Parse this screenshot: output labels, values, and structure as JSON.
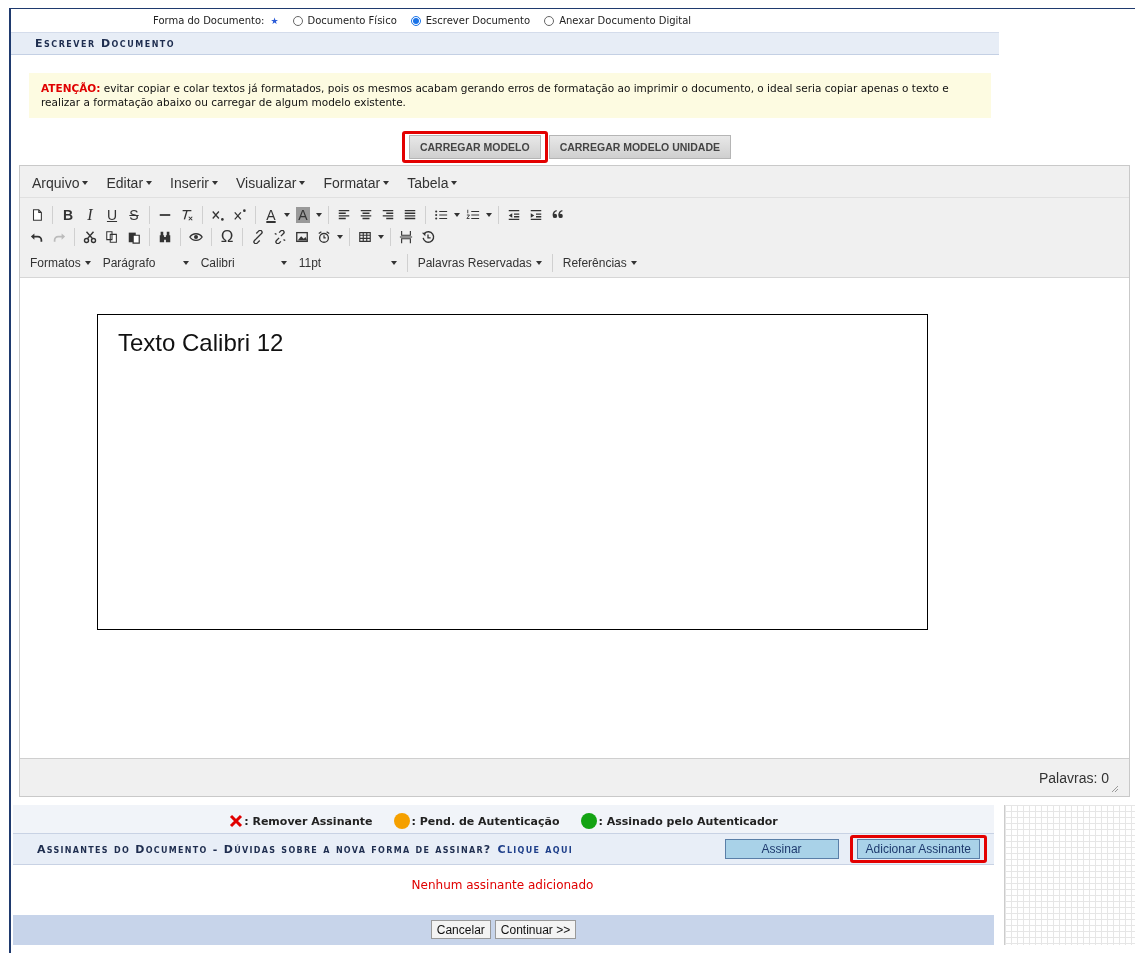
{
  "document_form": {
    "label": "Forma do Documento:",
    "required_mark": "★",
    "options": [
      {
        "label": "Documento Físico",
        "selected": false
      },
      {
        "label": "Escrever Documento",
        "selected": true
      },
      {
        "label": "Anexar Documento Digital",
        "selected": false
      }
    ]
  },
  "section": {
    "title": "Escrever Documento"
  },
  "warning": {
    "text": "**ATENÇÃO:** evitar copiar e colar textos já formatados, pois os mesmos acabam gerando erros de formatação ao imprimir o documento, o ideal seria copiar apenas o texto e realizar a formatação abaixo ou carregar de algum modelo existente."
  },
  "template_buttons": [
    {
      "label": "CARREGAR MODELO",
      "highlighted": true
    },
    {
      "label": "CARREGAR MODELO UNIDADE",
      "highlighted": false
    }
  ],
  "editor": {
    "menus": [
      "Arquivo",
      "Editar",
      "Inserir",
      "Visualizar",
      "Formatar",
      "Tabela"
    ],
    "glyphs": [
      "B",
      "I",
      "U",
      "S",
      "A",
      "A",
      "Ω"
    ],
    "selects": [
      {
        "label": "Formatos",
        "kind": "menu"
      },
      {
        "label": "Parágrafo",
        "kind": "select"
      },
      {
        "label": "Calibri",
        "kind": "select"
      },
      {
        "label": "11pt",
        "kind": "select"
      },
      {
        "label": "Palavras Reservadas",
        "kind": "menu"
      },
      {
        "label": "Referências",
        "kind": "menu"
      }
    ],
    "content": "Texto Calibri 12",
    "word_count": "Palavras: 0"
  },
  "legend": [
    {
      "kind": "remove",
      "label": ": Remover Assinante"
    },
    {
      "kind": "dot",
      "color": "#f5a000",
      "label": ": Pend. de Autenticação"
    },
    {
      "kind": "dot",
      "color": "#13a313",
      "label": ": Assinado pelo Autenticador"
    }
  ],
  "signers": {
    "title": "Assinantes do Documento - Dúvidas sobre a nova forma de assinar?",
    "link": "Clique aqui",
    "buttons": [
      {
        "label": "Assinar",
        "highlighted": false
      },
      {
        "label": "Adicionar Assinante",
        "highlighted": true
      }
    ],
    "empty_message": "Nenhum assinante adicionado"
  },
  "footer_buttons": [
    "Cancelar",
    "Continuar >>"
  ]
}
